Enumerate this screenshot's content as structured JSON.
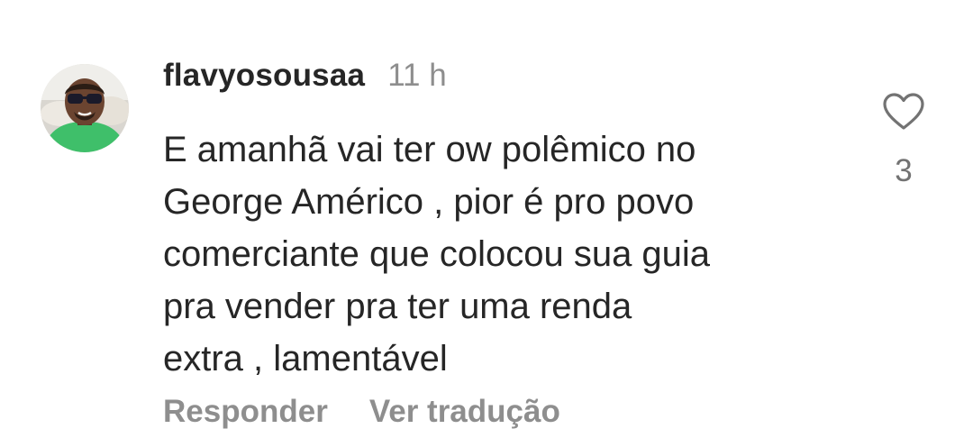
{
  "comment": {
    "username": "flavyosousaa",
    "time_ago": "11 h",
    "text_lines": [
      "E amanhã vai ter ow polêmico no",
      "George Américo , pior é pro povo",
      "comerciante que colocou sua guia",
      "pra vender pra ter uma renda",
      "extra , lamentável"
    ],
    "like_count": "3",
    "actions": {
      "reply_label": "Responder",
      "translate_label": "Ver tradução"
    }
  },
  "icons": {
    "avatar": "user-avatar",
    "like": "heart-icon"
  },
  "colors": {
    "text": "#262626",
    "secondary": "#8e8e8e",
    "avatar_shirt": "#3fbf6a"
  }
}
